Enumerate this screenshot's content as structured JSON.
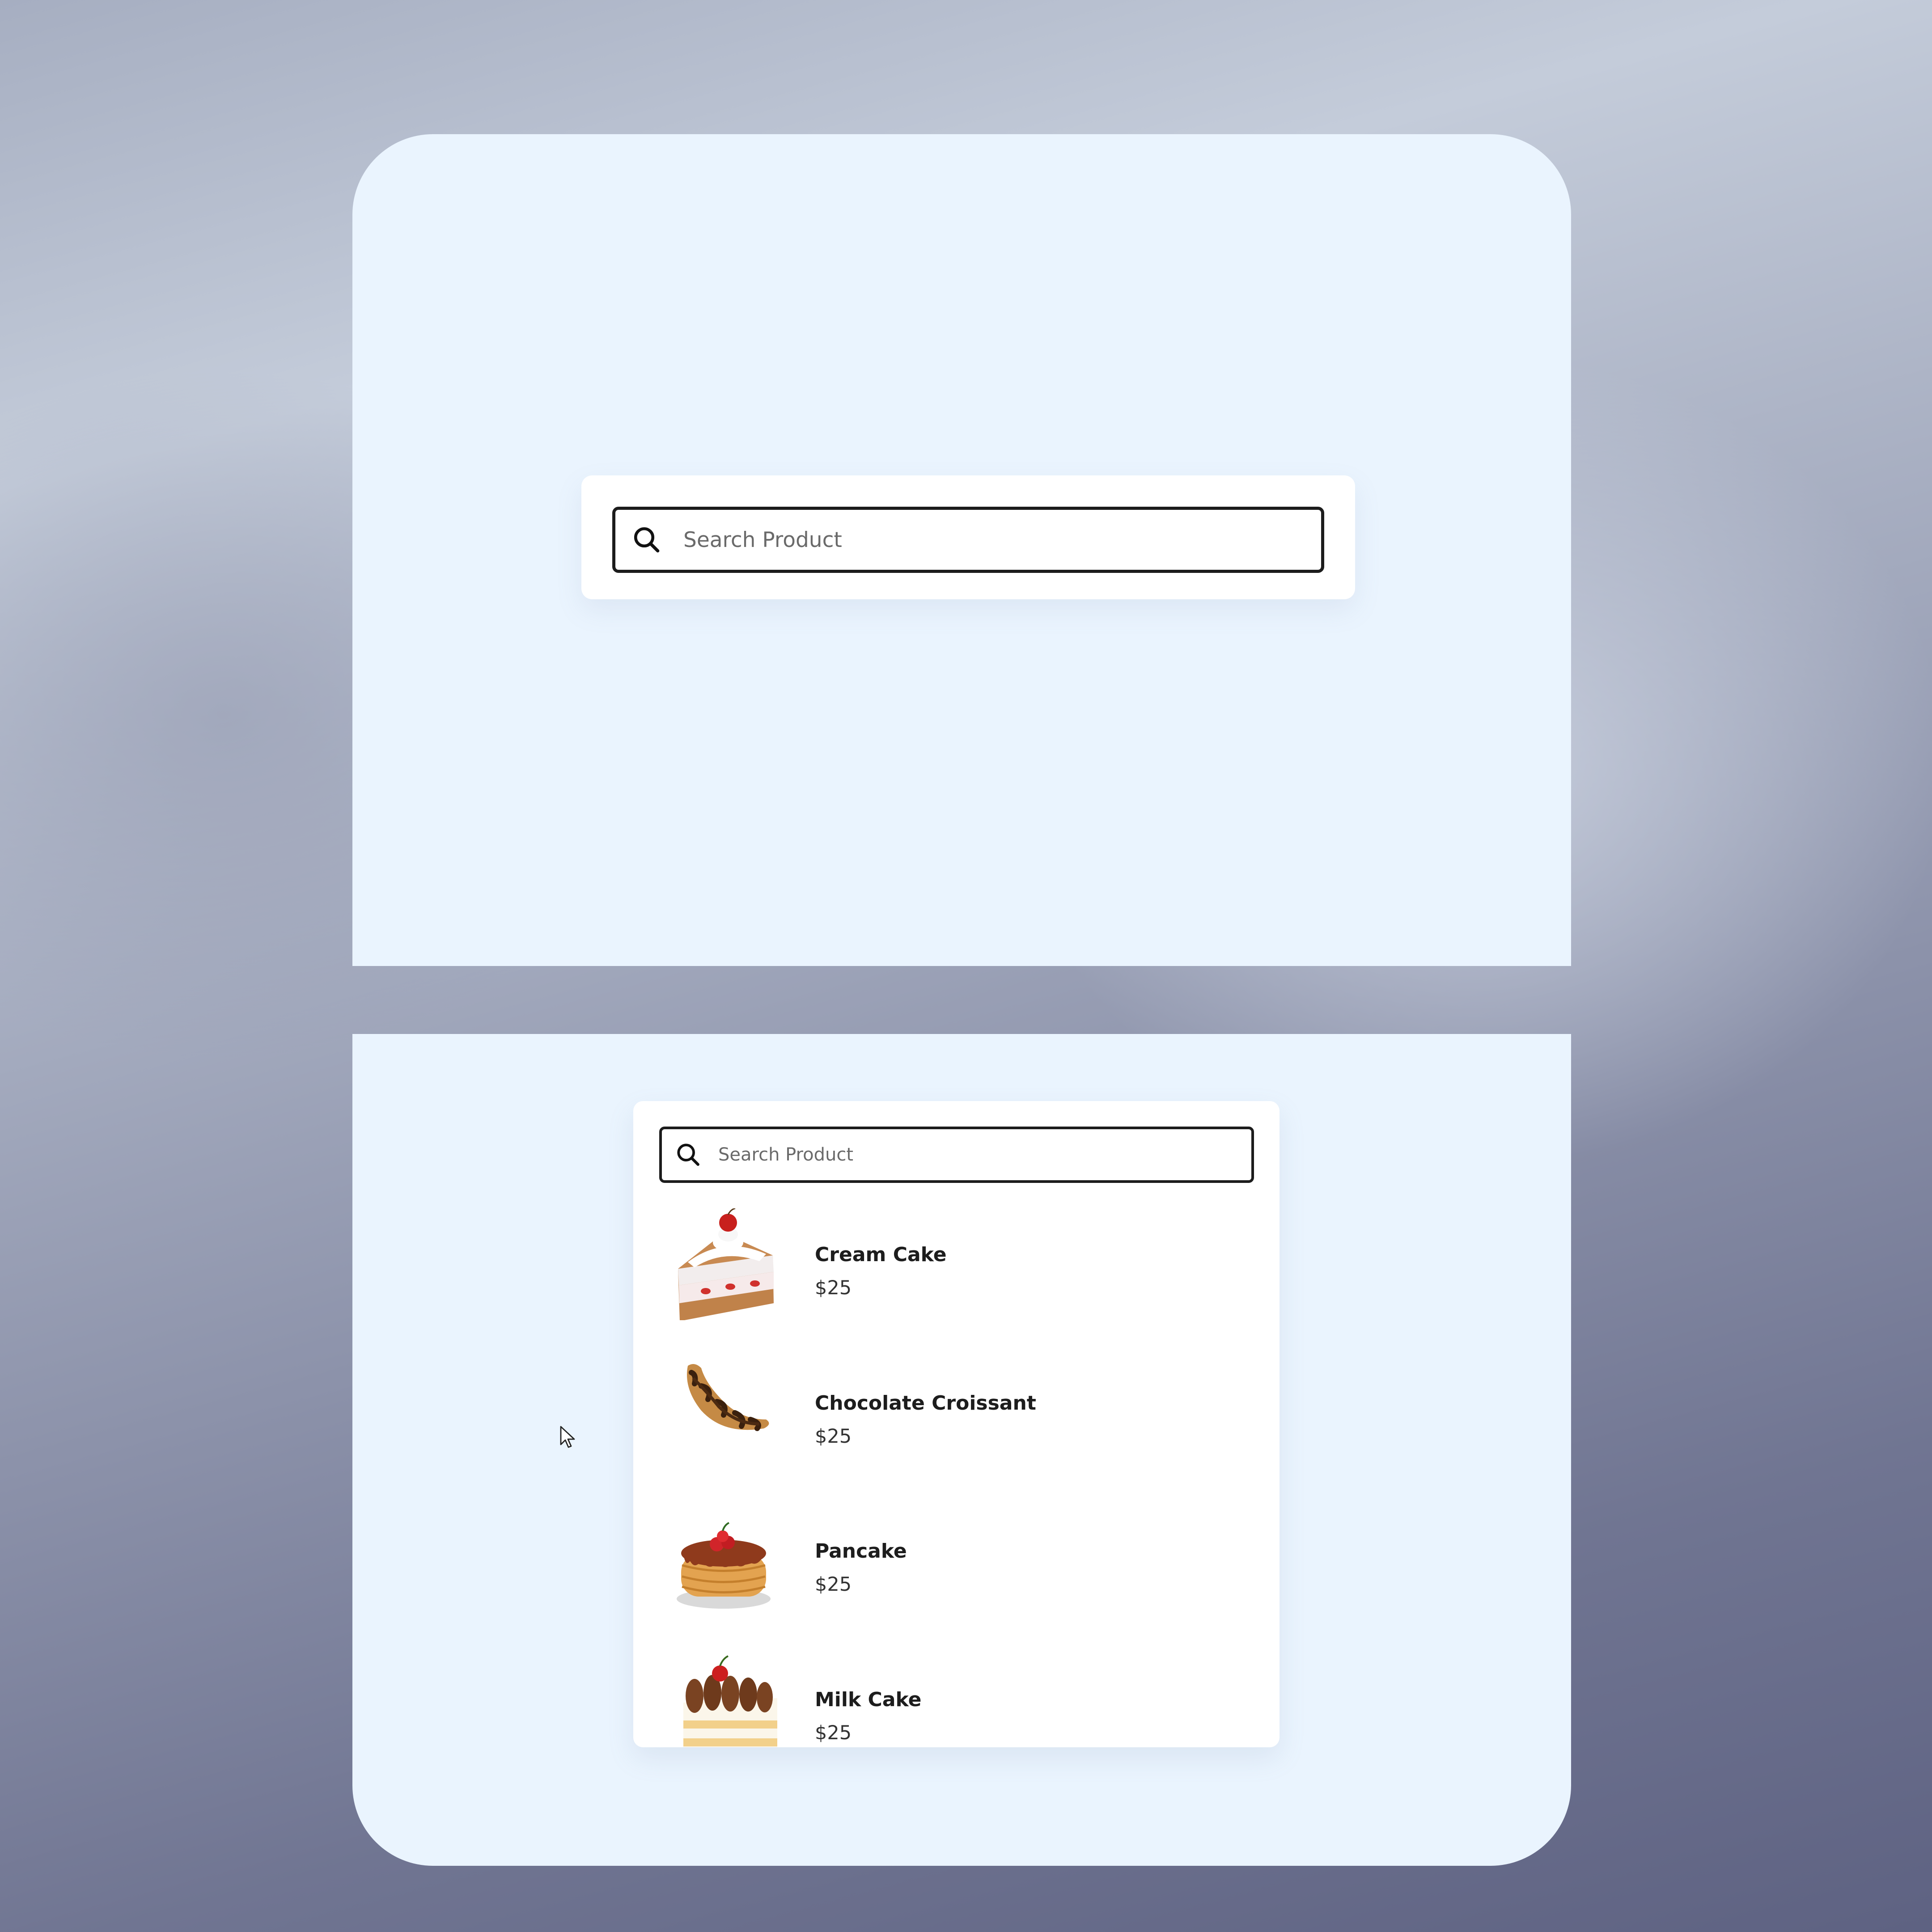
{
  "search": {
    "placeholder": "Search Product"
  },
  "products": [
    {
      "name": "Cream Cake",
      "price": "$25",
      "image": "cream-cake-image"
    },
    {
      "name": "Chocolate Croissant",
      "price": "$25",
      "image": "chocolate-croissant-image"
    },
    {
      "name": "Pancake",
      "price": "$25",
      "image": "pancake-image"
    },
    {
      "name": "Milk Cake",
      "price": "$25",
      "image": "milk-cake-image"
    }
  ],
  "icons": {
    "search": "search-icon",
    "cursor": "mouse-pointer-icon"
  }
}
